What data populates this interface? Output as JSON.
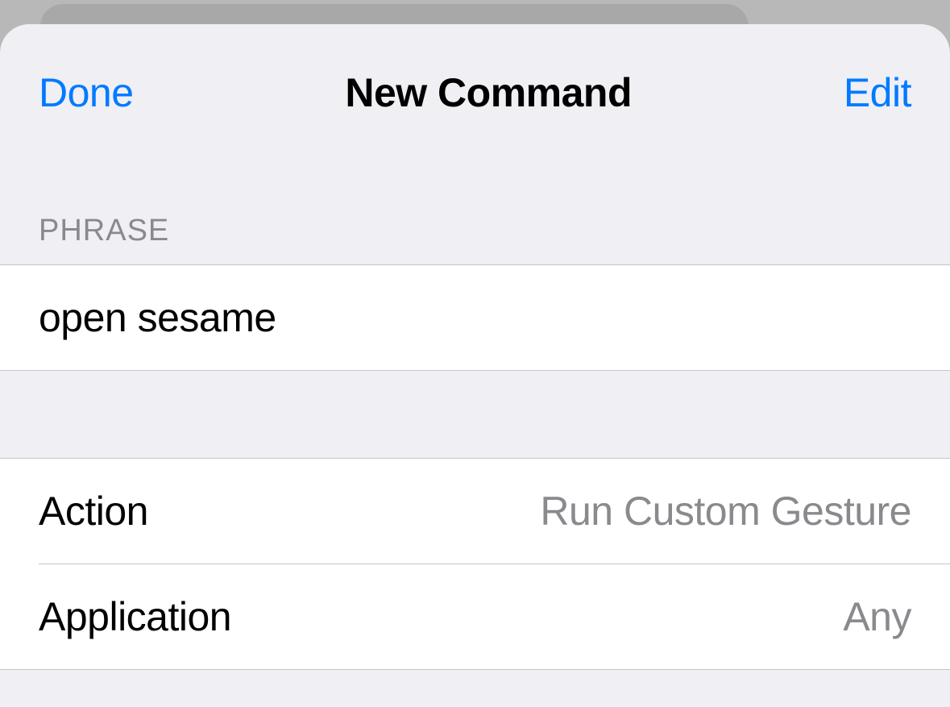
{
  "nav": {
    "done": "Done",
    "title": "New Command",
    "edit": "Edit"
  },
  "phrase": {
    "header": "PHRASE",
    "value": "open sesame"
  },
  "rows": {
    "action": {
      "label": "Action",
      "value": "Run Custom Gesture"
    },
    "application": {
      "label": "Application",
      "value": "Any"
    }
  }
}
